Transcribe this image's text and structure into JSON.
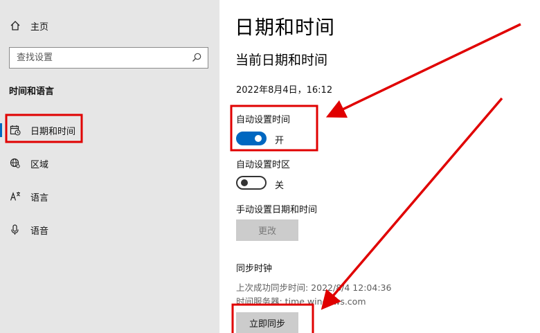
{
  "sidebar": {
    "home_label": "主页",
    "search_placeholder": "查找设置",
    "section_title": "时间和语言",
    "items": [
      {
        "label": "日期和时间",
        "icon": "calendar-clock-icon",
        "active": true
      },
      {
        "label": "区域",
        "icon": "globe-region-icon"
      },
      {
        "label": "语言",
        "icon": "language-icon"
      },
      {
        "label": "语音",
        "icon": "microphone-icon"
      }
    ]
  },
  "main": {
    "title": "日期和时间",
    "subtitle": "当前日期和时间",
    "current_datetime": "2022年8月4日，16:12",
    "auto_time": {
      "label": "自动设置时间",
      "state": "开",
      "on": true
    },
    "auto_timezone": {
      "label": "自动设置时区",
      "state": "关",
      "on": false
    },
    "manual": {
      "label": "手动设置日期和时间",
      "button": "更改"
    },
    "sync": {
      "label": "同步时钟",
      "last_sync": "上次成功同步时间: 2022/8/4 12:04:36",
      "server": "时间服务器: time.windows.com",
      "button": "立即同步"
    }
  },
  "colors": {
    "accent": "#0067c0",
    "annotation": "#e00000",
    "sidebar_bg": "#e6e6e6"
  }
}
